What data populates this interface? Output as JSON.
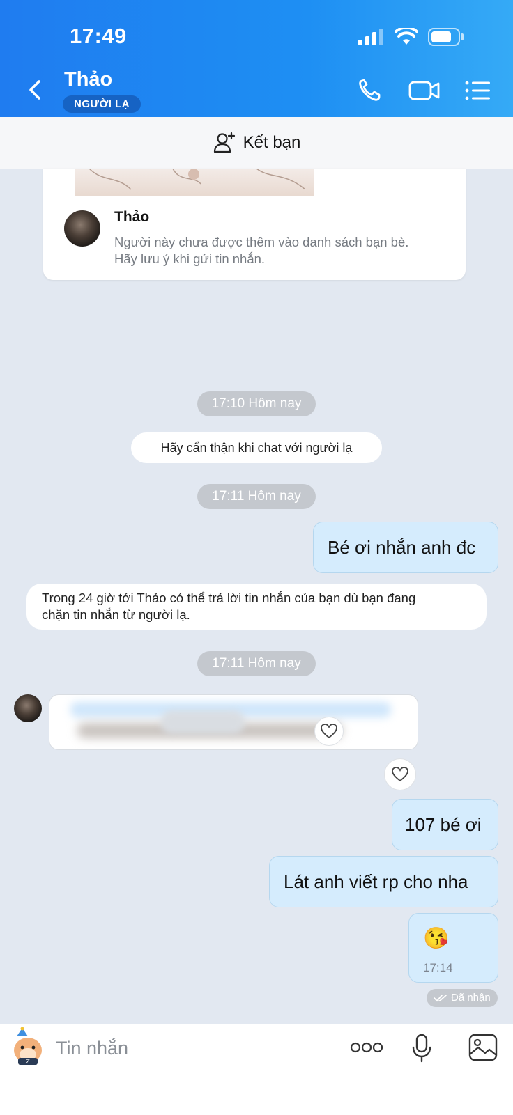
{
  "status_bar": {
    "time": "17:49"
  },
  "header": {
    "contact_name": "Thảo",
    "badge": "NGƯỜI LẠ"
  },
  "add_friend": {
    "label": "Kết bạn"
  },
  "profile_card": {
    "name": "Thảo",
    "note_line1": "Người này chưa được thêm vào danh sách bạn bè.",
    "note_line2": "Hãy lưu ý khi gửi tin nhắn."
  },
  "messages": {
    "time_pill_1": "17:10 Hôm nay",
    "system_warning": "Hãy cẩn thận khi chat với người lạ",
    "time_pill_2": "17:11 Hôm nay",
    "out_1": "Bé ơi nhắn anh đc",
    "system_info_line1": "Trong 24 giờ tới Thảo có thể trả lời tin nhắn của bạn dù bạn đang",
    "system_info_line2": "chặn tin nhắn từ người lạ.",
    "time_pill_3": "17:11 Hôm nay",
    "out_2": "107 bé ơi",
    "out_3": "Lát anh viết rp cho nha",
    "out_4_emoji": "😘",
    "out_4_time": "17:14",
    "delivery_status": "Đã nhận"
  },
  "composer": {
    "placeholder": "Tin nhắn"
  },
  "colors": {
    "header_blue": "#1e8ff3",
    "chat_background": "#e2e8f1",
    "outgoing_bubble": "#d5ecfd"
  },
  "icons": [
    "back-icon",
    "phone-icon",
    "video-call-icon",
    "menu-icon",
    "add-friend-icon",
    "heart-icon",
    "more-icon",
    "microphone-icon",
    "image-icon",
    "sticker-icon"
  ]
}
